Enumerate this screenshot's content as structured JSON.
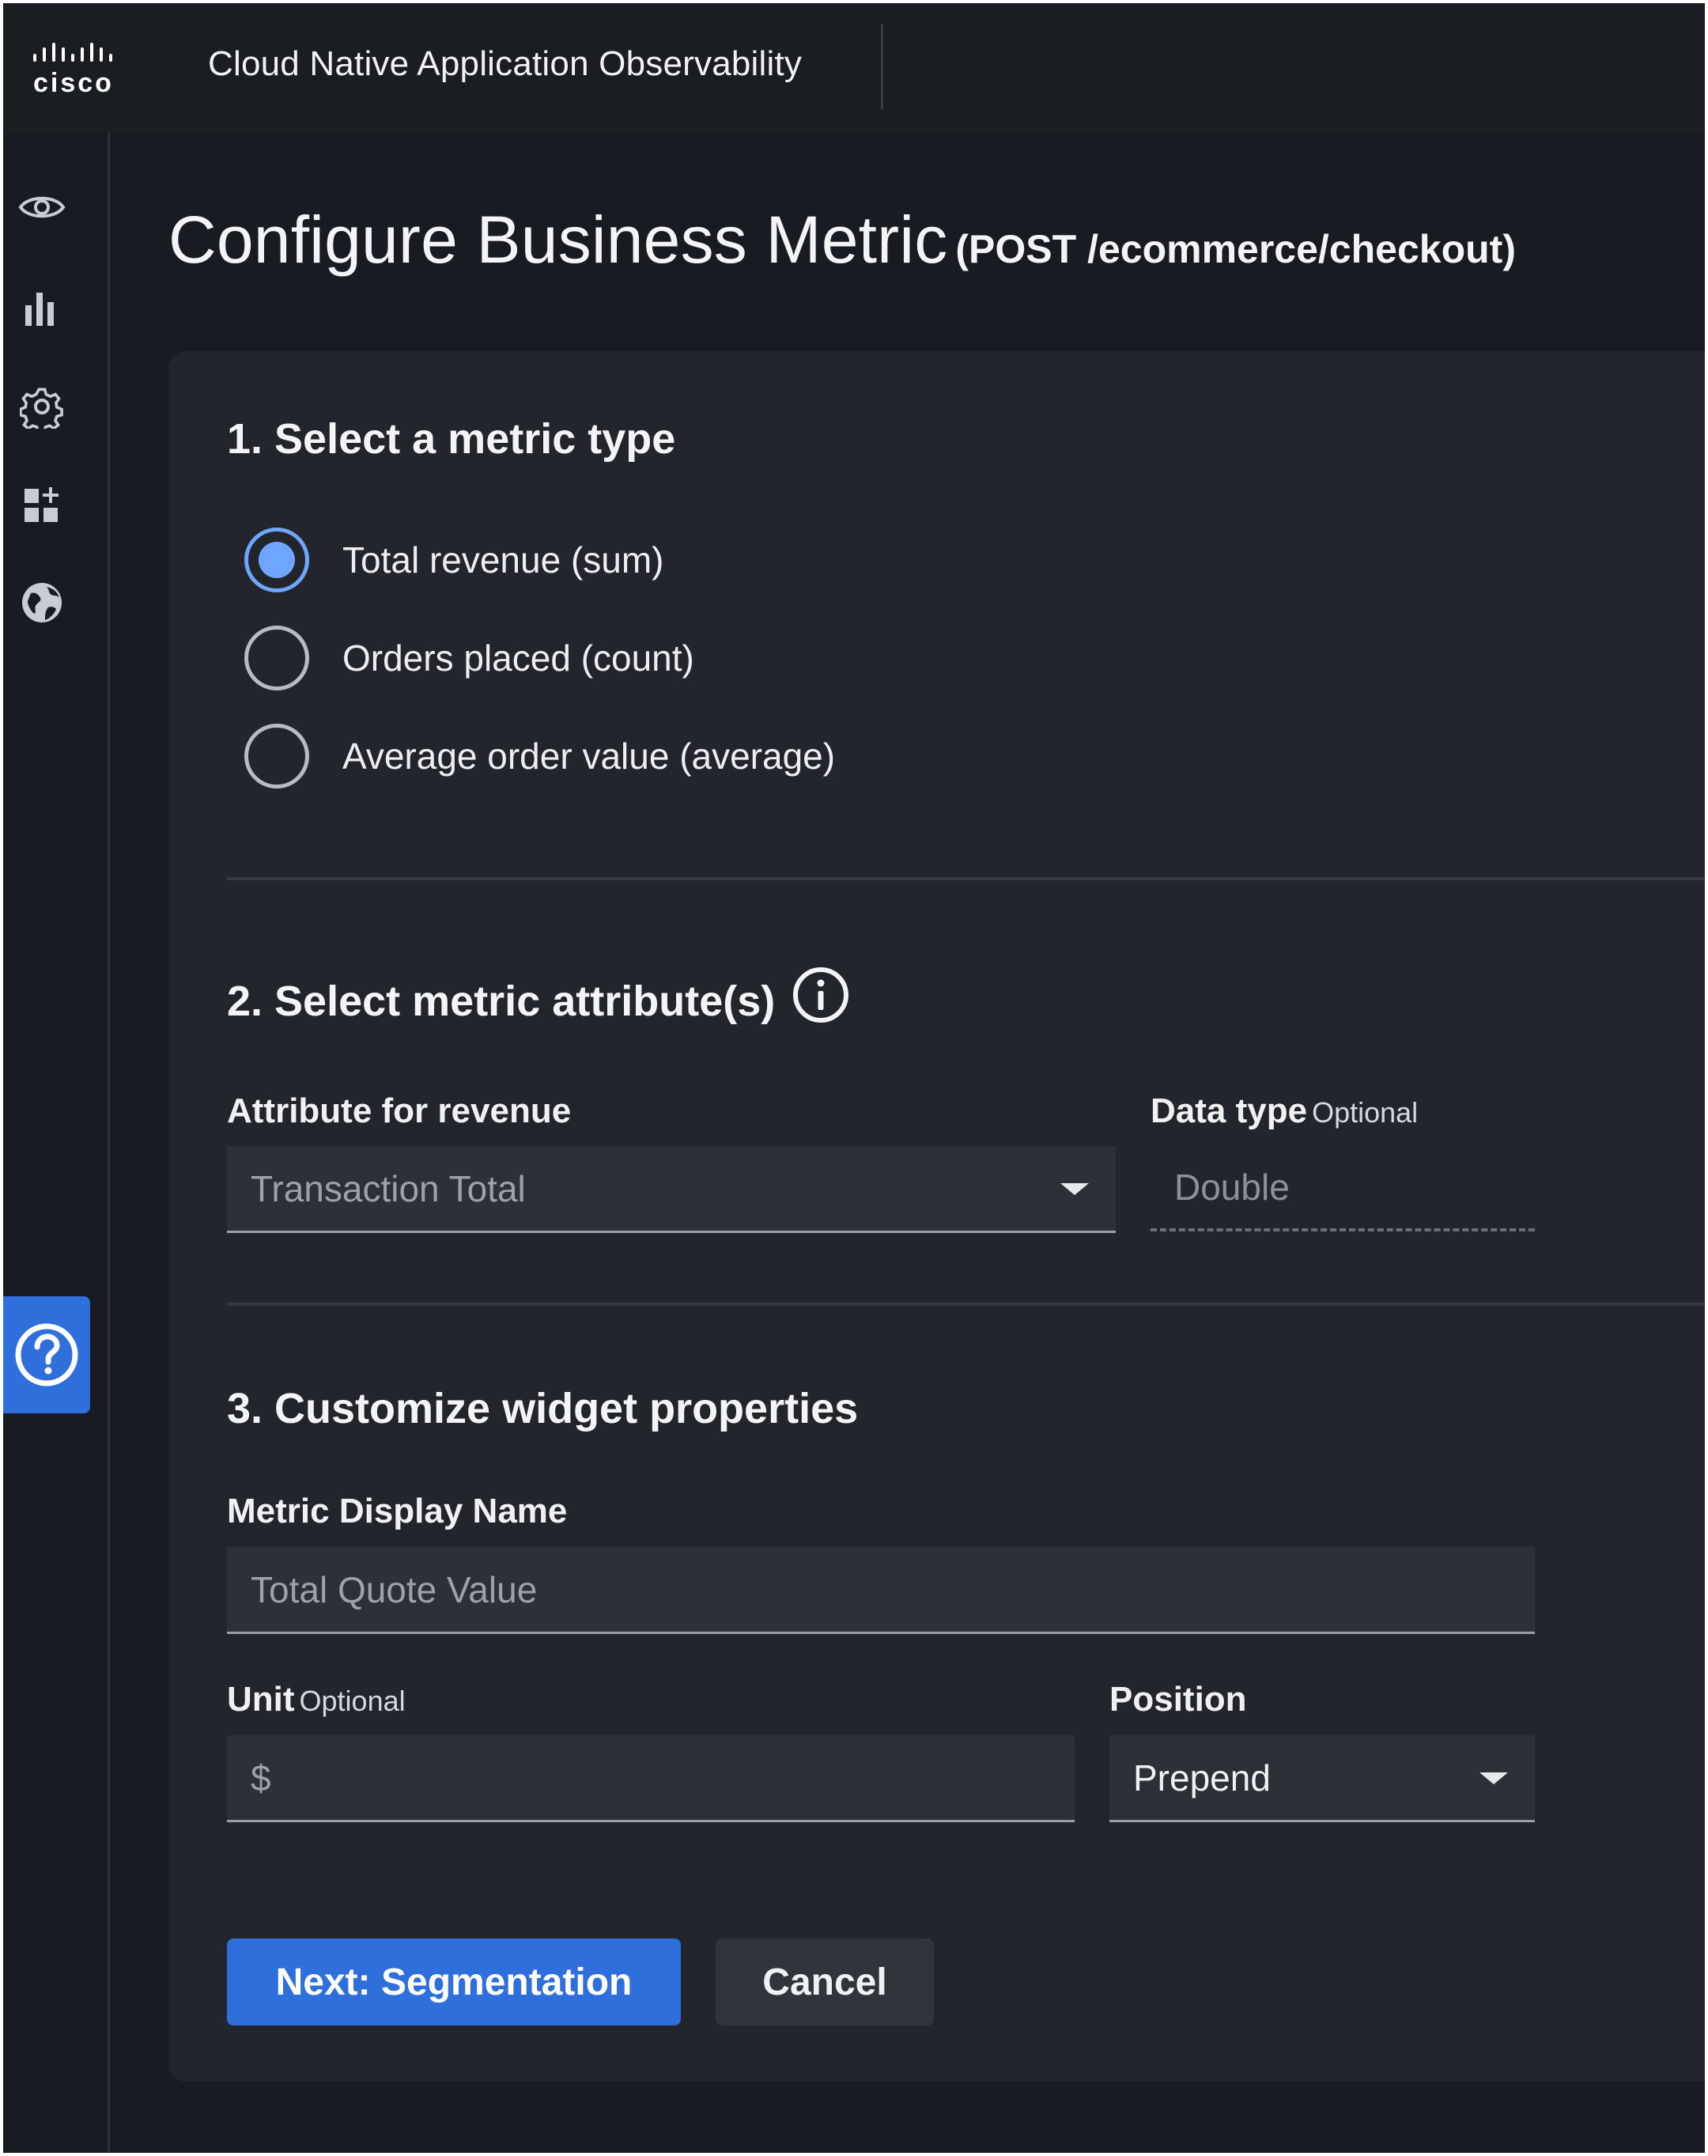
{
  "header": {
    "logo_text": "cisco",
    "app_title": "Cloud Native Application Observability"
  },
  "left_nav": {
    "icons": [
      "eye-icon",
      "bar-chart-icon",
      "gear-icon",
      "dashboard-add-icon",
      "globe-icon"
    ],
    "help_icon": "question-circle-icon"
  },
  "page": {
    "title": "Configure Business Metric",
    "route": "(POST /ecommerce/checkout)"
  },
  "section1": {
    "title": "1. Select a metric type",
    "options": [
      {
        "label": "Total revenue (sum)",
        "selected": true
      },
      {
        "label": "Orders placed (count)",
        "selected": false
      },
      {
        "label": "Average order value (average)",
        "selected": false
      }
    ]
  },
  "section2": {
    "title": "2. Select metric attribute(s)",
    "info_icon": "info-circle-icon",
    "attribute_label": "Attribute for revenue",
    "attribute_value": "Transaction Total",
    "datatype_label": "Data type",
    "datatype_optional": "Optional",
    "datatype_value": "Double"
  },
  "section3": {
    "title": "3. Customize widget properties",
    "display_name_label": "Metric Display Name",
    "display_name_placeholder": "Total Quote Value",
    "unit_label": "Unit",
    "unit_optional": "Optional",
    "unit_placeholder": "$",
    "position_label": "Position",
    "position_value": "Prepend"
  },
  "buttons": {
    "next_label": "Next: Segmentation",
    "cancel_label": "Cancel"
  },
  "colors": {
    "accent": "#2f6fdb",
    "radio_selected": "#6ea6ff",
    "background": "#181b21",
    "card": "#22262c"
  }
}
